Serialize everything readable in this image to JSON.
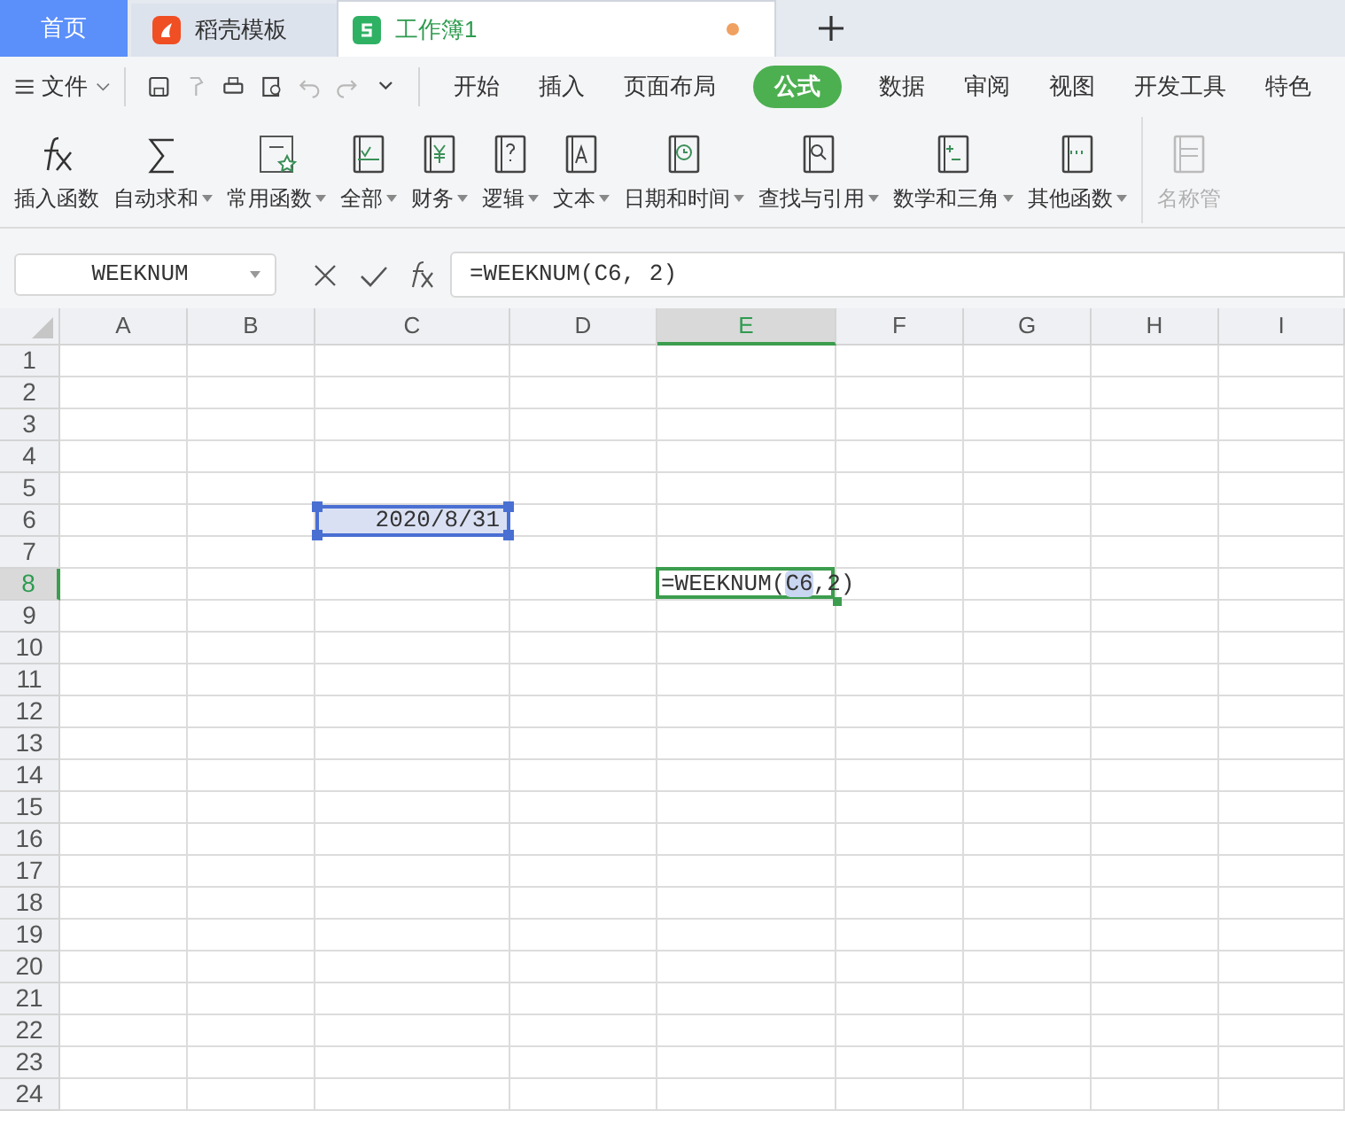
{
  "doc_tabs": [
    {
      "label": "首页",
      "kind": "home",
      "selected": false
    },
    {
      "label": "稻壳模板",
      "kind": "docer",
      "selected": false
    },
    {
      "label": "工作簿1",
      "kind": "sheet",
      "selected": true,
      "unsaved": true
    }
  ],
  "menu": {
    "file_label": "文件",
    "tabs": [
      {
        "label": "开始",
        "selected": false
      },
      {
        "label": "插入",
        "selected": false
      },
      {
        "label": "页面布局",
        "selected": false
      },
      {
        "label": "公式",
        "selected": true
      },
      {
        "label": "数据",
        "selected": false
      },
      {
        "label": "审阅",
        "selected": false
      },
      {
        "label": "视图",
        "selected": false
      },
      {
        "label": "开发工具",
        "selected": false
      },
      {
        "label": "特色",
        "selected": false
      }
    ]
  },
  "quick_tools": [
    {
      "kind": "save",
      "disabled": false
    },
    {
      "kind": "painter",
      "disabled": true
    },
    {
      "kind": "print",
      "disabled": false
    },
    {
      "kind": "preview",
      "disabled": false
    },
    {
      "kind": "undo",
      "disabled": true
    },
    {
      "kind": "redo",
      "disabled": true
    },
    {
      "kind": "more",
      "disabled": false
    }
  ],
  "ribbon": [
    {
      "label": "插入函数",
      "kind": "fx",
      "dropdown": false,
      "disabled": false
    },
    {
      "label": "自动求和",
      "kind": "sum",
      "dropdown": true,
      "disabled": false
    },
    {
      "label": "常用函数",
      "kind": "star",
      "dropdown": true,
      "disabled": false
    },
    {
      "label": "全部",
      "kind": "fxbook",
      "dropdown": true,
      "disabled": false
    },
    {
      "label": "财务",
      "kind": "money",
      "dropdown": true,
      "disabled": false
    },
    {
      "label": "逻辑",
      "kind": "logic",
      "dropdown": true,
      "disabled": false
    },
    {
      "label": "文本",
      "kind": "text",
      "dropdown": true,
      "disabled": false
    },
    {
      "label": "日期和时间",
      "kind": "clock",
      "dropdown": true,
      "disabled": false
    },
    {
      "label": "查找与引用",
      "kind": "search",
      "dropdown": true,
      "disabled": false
    },
    {
      "label": "数学和三角",
      "kind": "math",
      "dropdown": true,
      "disabled": false
    },
    {
      "label": "其他函数",
      "kind": "more",
      "dropdown": true,
      "disabled": false
    },
    {
      "label": "名称管",
      "kind": "name",
      "dropdown": false,
      "disabled": true
    }
  ],
  "formula_bar": {
    "name_box": "WEEKNUM",
    "formula": "=WEEKNUM(C6, 2)"
  },
  "sheet": {
    "columns": [
      {
        "label": "A",
        "selected": false
      },
      {
        "label": "B",
        "selected": false
      },
      {
        "label": "C",
        "selected": false
      },
      {
        "label": "D",
        "selected": false
      },
      {
        "label": "E",
        "selected": true
      },
      {
        "label": "F",
        "selected": false
      },
      {
        "label": "G",
        "selected": false
      },
      {
        "label": "H",
        "selected": false
      },
      {
        "label": "I",
        "selected": false
      }
    ],
    "rows": [
      {
        "label": "1",
        "selected": false
      },
      {
        "label": "2",
        "selected": false
      },
      {
        "label": "3",
        "selected": false
      },
      {
        "label": "4",
        "selected": false
      },
      {
        "label": "5",
        "selected": false
      },
      {
        "label": "6",
        "selected": false,
        "cells": [
          null,
          null,
          {
            "kind": "value",
            "value": "2020/8/31",
            "referenced": true
          }
        ]
      },
      {
        "label": "7",
        "selected": false
      },
      {
        "label": "8",
        "selected": true,
        "cells": [
          null,
          null,
          null,
          null,
          {
            "kind": "editing",
            "prefix": "=WEEKNUM(",
            "reference": "C6",
            "suffix": ",2)",
            "active": true
          }
        ]
      },
      {
        "label": "9",
        "selected": false
      },
      {
        "label": "10",
        "selected": false
      },
      {
        "label": "11",
        "selected": false
      },
      {
        "label": "12",
        "selected": false
      },
      {
        "label": "13",
        "selected": false
      },
      {
        "label": "14",
        "selected": false
      },
      {
        "label": "15",
        "selected": false
      },
      {
        "label": "16",
        "selected": false
      },
      {
        "label": "17",
        "selected": false
      },
      {
        "label": "18",
        "selected": false
      },
      {
        "label": "19",
        "selected": false
      },
      {
        "label": "20",
        "selected": false
      },
      {
        "label": "21",
        "selected": false
      },
      {
        "label": "22",
        "selected": false
      },
      {
        "label": "23",
        "selected": false
      },
      {
        "label": "24",
        "selected": false
      }
    ]
  }
}
